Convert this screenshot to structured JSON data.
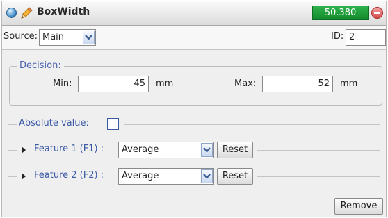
{
  "header": {
    "title": "BoxWidth",
    "value": "50.380"
  },
  "source": {
    "label": "Source:",
    "selected": "Main",
    "id_label": "ID:",
    "id_value": "2"
  },
  "decision": {
    "legend": "Decision:",
    "min_label": "Min:",
    "min_value": "45",
    "min_unit": "mm",
    "max_label": "Max:",
    "max_value": "52",
    "max_unit": "mm"
  },
  "absolute": {
    "label": "Absolute value:",
    "checked": false
  },
  "features": [
    {
      "label": "Feature 1 (F1) :",
      "mode": "Average",
      "reset_label": "Reset"
    },
    {
      "label": "Feature 2 (F2) :",
      "mode": "Average",
      "reset_label": "Reset"
    }
  ],
  "footer": {
    "remove_label": "Remove"
  },
  "colors": {
    "accent_blue": "#3a5aa6",
    "value_green": "#1e9b3a",
    "remove_red": "#d44a4a"
  }
}
